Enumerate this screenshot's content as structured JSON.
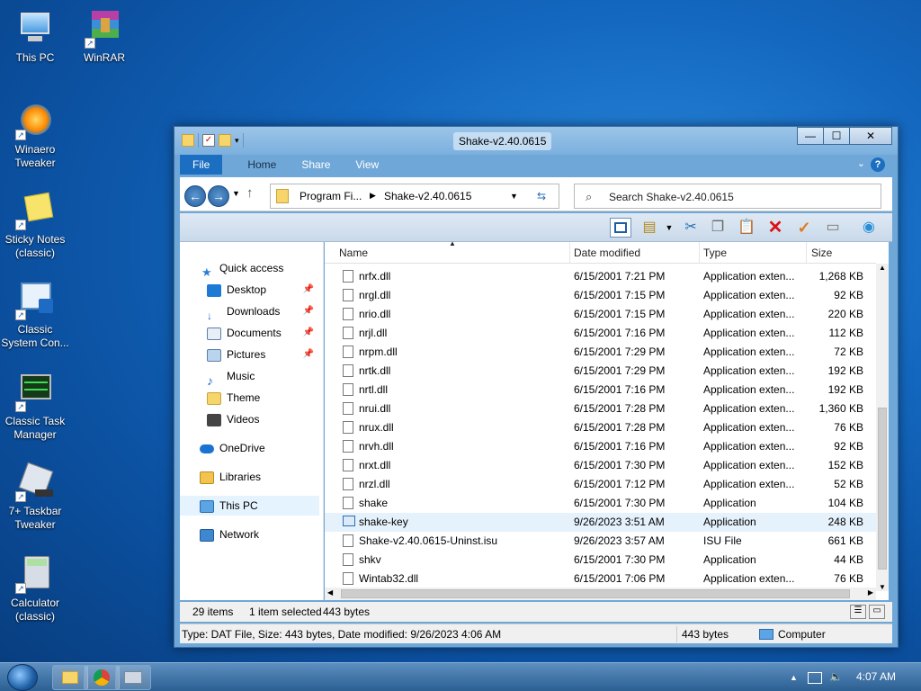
{
  "desktop": {
    "icons": [
      {
        "label": "This PC"
      },
      {
        "label": "WinRAR"
      },
      {
        "label": "Winaero Tweaker"
      },
      {
        "label": "Sticky Notes (classic)"
      },
      {
        "label": "Classic System Con..."
      },
      {
        "label": "Classic Task Manager"
      },
      {
        "label": "7+ Taskbar Tweaker"
      },
      {
        "label": "Calculator (classic)"
      }
    ]
  },
  "window": {
    "title": "Shake-v2.40.0615",
    "controls": {
      "minimize": "—",
      "maximize": "☐",
      "close": "✕"
    },
    "ribbon_tabs": [
      "File",
      "Home",
      "Share",
      "View"
    ],
    "address": {
      "crumb1": "Program Fi...",
      "crumb2": "Shake-v2.40.0615"
    },
    "search_placeholder": "Search Shake-v2.40.0615"
  },
  "nav": {
    "items": [
      {
        "label": "Quick access"
      },
      {
        "label": "Desktop"
      },
      {
        "label": "Downloads"
      },
      {
        "label": "Documents"
      },
      {
        "label": "Pictures"
      },
      {
        "label": "Music"
      },
      {
        "label": "Theme"
      },
      {
        "label": "Videos"
      },
      {
        "label": "OneDrive"
      },
      {
        "label": "Libraries"
      },
      {
        "label": "This PC"
      },
      {
        "label": "Network"
      }
    ]
  },
  "columns": {
    "name": "Name",
    "date": "Date modified",
    "type": "Type",
    "size": "Size"
  },
  "files": [
    {
      "name": "nrfx.dll",
      "date": "6/15/2001 7:21 PM",
      "type": "Application exten...",
      "size": "1,268 KB"
    },
    {
      "name": "nrgl.dll",
      "date": "6/15/2001 7:15 PM",
      "type": "Application exten...",
      "size": "92 KB"
    },
    {
      "name": "nrio.dll",
      "date": "6/15/2001 7:15 PM",
      "type": "Application exten...",
      "size": "220 KB"
    },
    {
      "name": "nrjl.dll",
      "date": "6/15/2001 7:16 PM",
      "type": "Application exten...",
      "size": "112 KB"
    },
    {
      "name": "nrpm.dll",
      "date": "6/15/2001 7:29 PM",
      "type": "Application exten...",
      "size": "72 KB"
    },
    {
      "name": "nrtk.dll",
      "date": "6/15/2001 7:29 PM",
      "type": "Application exten...",
      "size": "192 KB"
    },
    {
      "name": "nrtl.dll",
      "date": "6/15/2001 7:16 PM",
      "type": "Application exten...",
      "size": "192 KB"
    },
    {
      "name": "nrui.dll",
      "date": "6/15/2001 7:28 PM",
      "type": "Application exten...",
      "size": "1,360 KB"
    },
    {
      "name": "nrux.dll",
      "date": "6/15/2001 7:28 PM",
      "type": "Application exten...",
      "size": "76 KB"
    },
    {
      "name": "nrvh.dll",
      "date": "6/15/2001 7:16 PM",
      "type": "Application exten...",
      "size": "92 KB"
    },
    {
      "name": "nrxt.dll",
      "date": "6/15/2001 7:30 PM",
      "type": "Application exten...",
      "size": "152 KB"
    },
    {
      "name": "nrzl.dll",
      "date": "6/15/2001 7:12 PM",
      "type": "Application exten...",
      "size": "52 KB"
    },
    {
      "name": "shake",
      "date": "6/15/2001 7:30 PM",
      "type": "Application",
      "size": "104 KB"
    },
    {
      "name": "shake-key",
      "date": "9/26/2023 3:51 AM",
      "type": "Application",
      "size": "248 KB"
    },
    {
      "name": "Shake-v2.40.0615-Uninst.isu",
      "date": "9/26/2023 3:57 AM",
      "type": "ISU File",
      "size": "661 KB"
    },
    {
      "name": "shkv",
      "date": "6/15/2001 7:30 PM",
      "type": "Application",
      "size": "44 KB"
    },
    {
      "name": "Wintab32.dll",
      "date": "6/15/2001 7:06 PM",
      "type": "Application exten...",
      "size": "76 KB"
    }
  ],
  "status": {
    "count": "29 items",
    "selected": "1 item selected",
    "bytes": "443 bytes"
  },
  "details": {
    "text": "Type: DAT File, Size: 443 bytes, Date modified: 9/26/2023 4:06 AM",
    "size": "443 bytes",
    "location": "Computer"
  },
  "taskbar": {
    "time": "4:07 AM"
  }
}
